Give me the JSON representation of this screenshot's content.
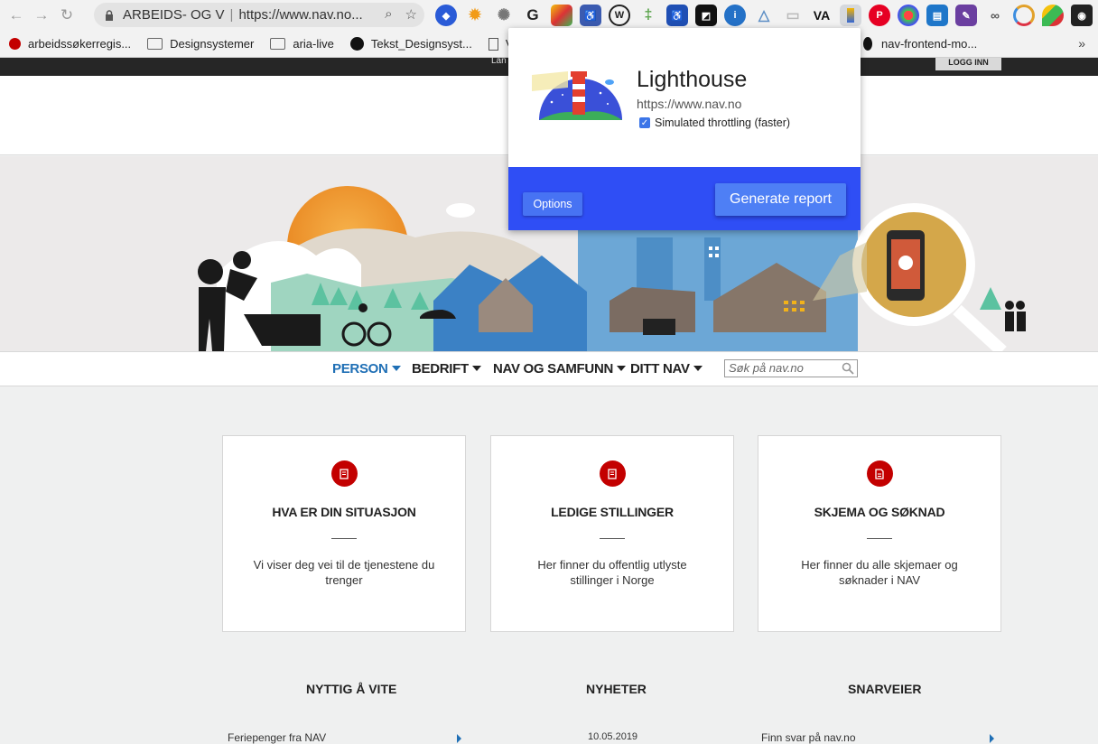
{
  "browser": {
    "site_label": "ARBEIDS- OG V",
    "url": "https://www.nav.no...",
    "bookmarks": [
      "arbeidssøkerregis...",
      "Designsystemer",
      "aria-live",
      "Tekst_Designsyst...",
      "V",
      "nav-frontend-mo..."
    ],
    "more": "»"
  },
  "page": {
    "login_label": "LOGG INN",
    "top_text": "Lan",
    "nav": [
      "PERSON",
      "BEDRIFT",
      "NAV OG SAMFUNN",
      "DITT NAV"
    ],
    "search_placeholder": "Søk på nav.no",
    "cards": [
      {
        "title": "HVA ER DIN SITUASJON",
        "text": "Vi viser deg vei til de tjenestene du trenger"
      },
      {
        "title": "LEDIGE STILLINGER",
        "text": "Her finner du offentlig utlyste stillinger i Norge"
      },
      {
        "title": "SKJEMA OG SØKNAD",
        "text": "Her finner du alle skjemaer og søknader i NAV"
      }
    ],
    "sections": [
      "NYTTIG Å VITE",
      "NYHETER",
      "SNARVEIER"
    ],
    "section_items": [
      "Feriepenger fra NAV",
      "10.05.2019",
      "Finn svar på nav.no"
    ]
  },
  "lighthouse": {
    "title": "Lighthouse",
    "url": "https://www.nav.no",
    "throttle_label": "Simulated throttling (faster)",
    "options_label": "Options",
    "generate_label": "Generate report"
  },
  "colors": {
    "accent_blue": "#2f4ef5",
    "nav_active": "#1f6fb5",
    "nav_red": "#c30000"
  }
}
